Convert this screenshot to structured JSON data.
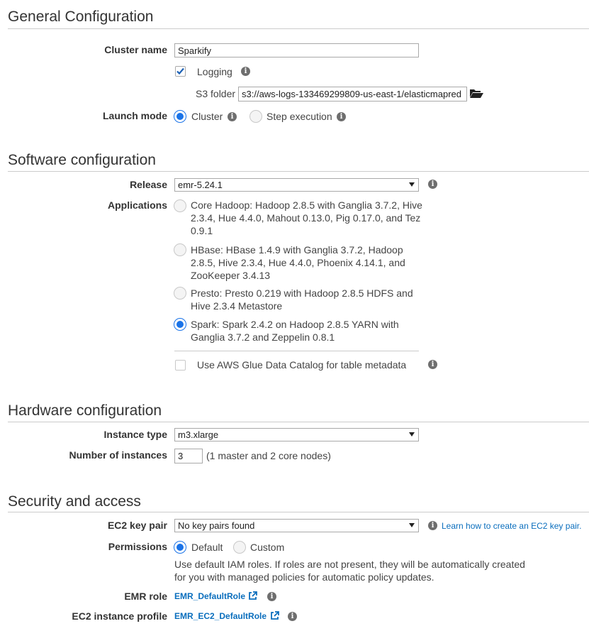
{
  "general": {
    "title": "General Configuration",
    "cluster_name_label": "Cluster name",
    "cluster_name_value": "Sparkify",
    "logging_label": "Logging",
    "s3_folder_label": "S3 folder",
    "s3_folder_value": "s3://aws-logs-133469299809-us-east-1/elasticmapred",
    "launch_mode_label": "Launch mode",
    "launch_mode_cluster": "Cluster",
    "launch_mode_step": "Step execution"
  },
  "software": {
    "title": "Software configuration",
    "release_label": "Release",
    "release_value": "emr-5.24.1",
    "applications_label": "Applications",
    "applications": [
      {
        "text": "Core Hadoop: Hadoop 2.8.5 with Ganglia 3.7.2, Hive 2.3.4, Hue 4.4.0, Mahout 0.13.0, Pig 0.17.0, and Tez 0.9.1",
        "selected": false
      },
      {
        "text": "HBase: HBase 1.4.9 with Ganglia 3.7.2, Hadoop 2.8.5, Hive 2.3.4, Hue 4.4.0, Phoenix 4.14.1, and ZooKeeper 3.4.13",
        "selected": false
      },
      {
        "text": "Presto: Presto 0.219 with Hadoop 2.8.5 HDFS and Hive 2.3.4 Metastore",
        "selected": false
      },
      {
        "text": "Spark: Spark 2.4.2 on Hadoop 2.8.5 YARN with Ganglia 3.7.2 and Zeppelin 0.8.1",
        "selected": true
      }
    ],
    "glue_label": "Use AWS Glue Data Catalog for table metadata"
  },
  "hardware": {
    "title": "Hardware configuration",
    "instance_type_label": "Instance type",
    "instance_type_value": "m3.xlarge",
    "num_instances_label": "Number of instances",
    "num_instances_value": "3",
    "num_instances_note": "(1 master and 2 core nodes)"
  },
  "security": {
    "title": "Security and access",
    "key_pair_label": "EC2 key pair",
    "key_pair_value": "No key pairs found",
    "key_pair_link": "Learn how to create an EC2 key pair.",
    "permissions_label": "Permissions",
    "permissions_default": "Default",
    "permissions_custom": "Custom",
    "permissions_note": "Use default IAM roles. If roles are not present, they will be automatically created for you with managed policies for automatic policy updates.",
    "emr_role_label": "EMR role",
    "emr_role_value": "EMR_DefaultRole",
    "ec2_profile_label": "EC2 instance profile",
    "ec2_profile_value": "EMR_EC2_DefaultRole"
  },
  "colors": {
    "accent": "#1a73e8",
    "link": "#0a6ebd",
    "info_icon": "#6e6e6e"
  }
}
